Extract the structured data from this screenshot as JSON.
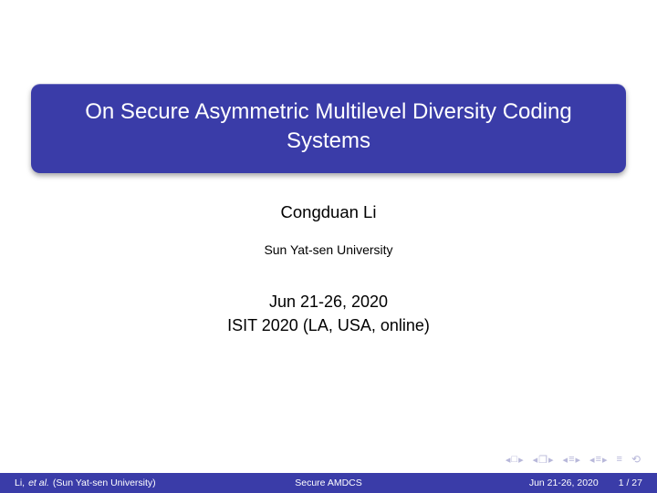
{
  "title": "On Secure Asymmetric Multilevel Diversity Coding Systems",
  "author": "Congduan Li",
  "affiliation": "Sun Yat-sen University",
  "date": "Jun 21-26, 2020",
  "venue": "ISIT 2020 (LA, USA, online)",
  "footer": {
    "author_short": "Li,",
    "etal": "et al.",
    "affil_short": "(Sun Yat-sen University)",
    "short_title": "Secure AMDCS",
    "date": "Jun 21-26, 2020",
    "page": "1 / 27"
  },
  "nav": {
    "left": "◂",
    "right": "▸",
    "box": "□",
    "doc": "❐",
    "lines1": "≡",
    "lines2": "≡",
    "lines_solo": "≡",
    "cycle": "⟲"
  }
}
